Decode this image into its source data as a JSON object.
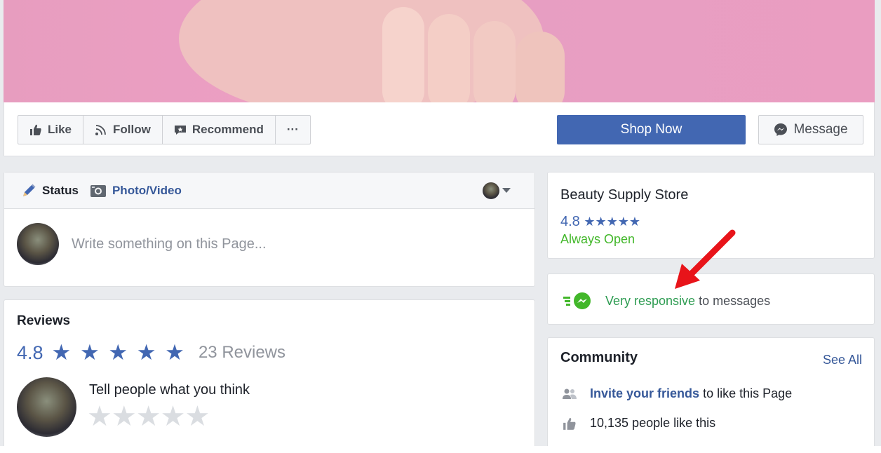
{
  "action_bar": {
    "like_label": "Like",
    "follow_label": "Follow",
    "recommend_label": "Recommend",
    "more_label": "···",
    "shop_now_label": "Shop Now",
    "message_label": "Message"
  },
  "composer": {
    "status_tab": "Status",
    "photo_tab": "Photo/Video",
    "placeholder": "Write something on this Page..."
  },
  "reviews": {
    "title": "Reviews",
    "score": "4.8",
    "stars": "★ ★ ★ ★ ★",
    "count": "23 Reviews",
    "prompt": "Tell people what you think",
    "empty_stars": "★★★★★"
  },
  "store": {
    "name": "Beauty Supply Store",
    "score": "4.8",
    "stars": "★★★★★",
    "hours": "Always Open"
  },
  "responsiveness": {
    "highlight": "Very responsive",
    "rest": "to messages"
  },
  "community": {
    "title": "Community",
    "see_all": "See All",
    "invite_link": "Invite your friends",
    "invite_rest": "to like this Page",
    "likes_text": "10,135 people like this"
  },
  "colors": {
    "brand_blue": "#4267b2",
    "link_blue": "#365899",
    "green": "#42b72a",
    "arrow_red": "#e8141a"
  }
}
